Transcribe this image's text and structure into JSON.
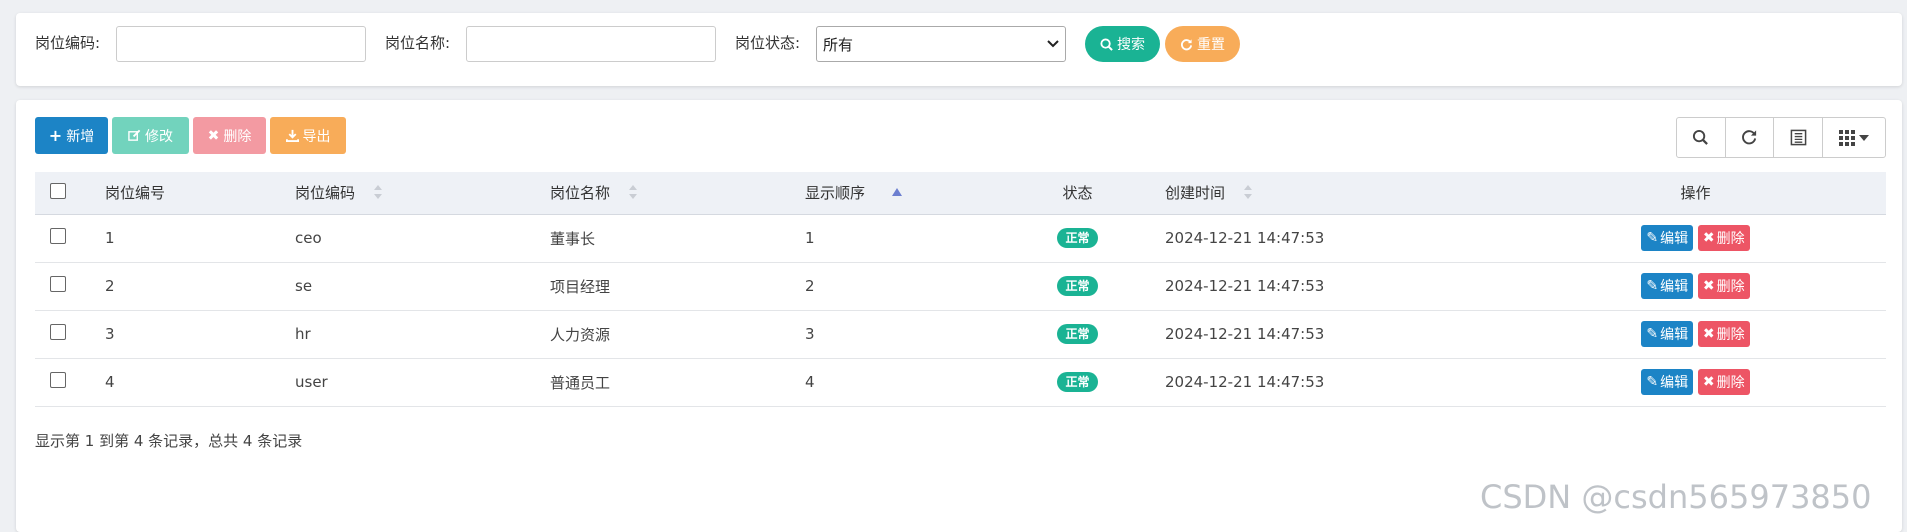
{
  "search": {
    "post_code_label": "岗位编码:",
    "post_name_label": "岗位名称:",
    "status_label": "岗位状态:",
    "status_value": "所有",
    "search_label": "搜索",
    "reset_label": "重置",
    "colors": {
      "search": "#1ab394",
      "reset": "#f8ac59"
    }
  },
  "toolbar": {
    "add_label": "新增",
    "edit_label": "修改",
    "delete_label": "删除",
    "export_label": "导出",
    "icons": [
      "search-icon",
      "refresh-icon",
      "card-view-icon",
      "columns-icon"
    ],
    "colors": {
      "add": "#1c84c6",
      "edit": "#72d3bd",
      "delete": "#f39aa2",
      "export": "#f8ac59"
    }
  },
  "table": {
    "headers": {
      "post_id": "岗位编号",
      "post_code": "岗位编码",
      "post_name": "岗位名称",
      "sort_order": "显示顺序",
      "status": "状态",
      "created": "创建时间",
      "actions": "操作"
    },
    "rows": [
      {
        "post_id": "1",
        "post_code": "ceo",
        "post_name": "董事长",
        "sort_order": "1",
        "status": "正常",
        "created": "2024-12-21 14:47:53",
        "edit": "编辑",
        "delete": "删除"
      },
      {
        "post_id": "2",
        "post_code": "se",
        "post_name": "项目经理",
        "sort_order": "2",
        "status": "正常",
        "created": "2024-12-21 14:47:53",
        "edit": "编辑",
        "delete": "删除"
      },
      {
        "post_id": "3",
        "post_code": "hr",
        "post_name": "人力资源",
        "sort_order": "3",
        "status": "正常",
        "created": "2024-12-21 14:47:53",
        "edit": "编辑",
        "delete": "删除"
      },
      {
        "post_id": "4",
        "post_code": "user",
        "post_name": "普通员工",
        "sort_order": "4",
        "status": "正常",
        "created": "2024-12-21 14:47:53",
        "edit": "编辑",
        "delete": "删除"
      }
    ]
  },
  "pagination": {
    "summary": "显示第 1 到第 4 条记录，总共 4 条记录"
  },
  "watermark": "CSDN @csdn565973850"
}
